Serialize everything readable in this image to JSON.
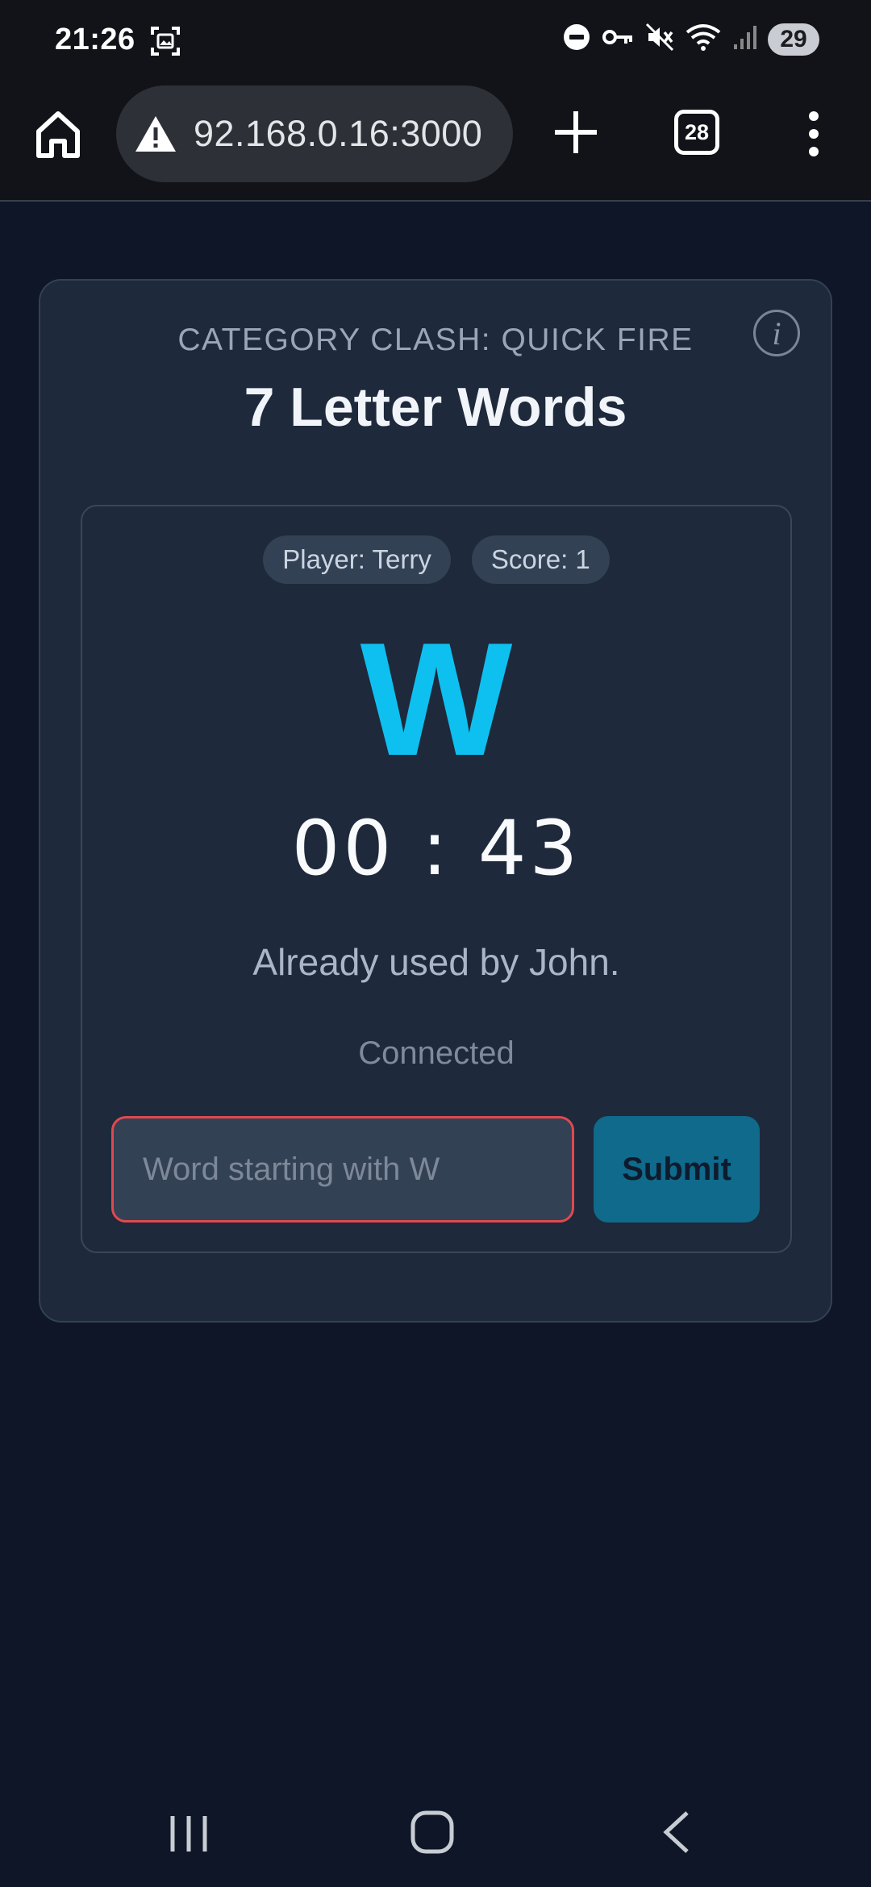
{
  "status_bar": {
    "time": "21:26",
    "battery": "29",
    "icons": [
      "screenshot-icon",
      "dnd-icon",
      "vpn-key-icon",
      "mute-icon",
      "wifi-icon",
      "signal-icon",
      "battery-icon"
    ]
  },
  "browser": {
    "url": "92.168.0.16:3000",
    "tab_count": "28",
    "icons": [
      "home-icon",
      "security-warning-icon",
      "new-tab-icon",
      "tabs-icon",
      "more-menu-icon"
    ]
  },
  "game": {
    "subtitle": "CATEGORY CLASH: QUICK FIRE",
    "title": "7 Letter Words",
    "player_badge": "Player: Terry",
    "score_badge": "Score: 1",
    "letter": "W",
    "timer": "00 : 43",
    "message": "Already used by John.",
    "connection": "Connected",
    "input_placeholder": "Word starting with W",
    "submit_label": "Submit",
    "info_symbol": "i"
  },
  "colors": {
    "background": "#0e1628",
    "card": "#1e293b",
    "accent_letter": "#0ec0f0",
    "submit_button": "#0f6a8c",
    "input_error_border": "#e0494f"
  },
  "nav_bar": {
    "icons": [
      "recents-icon",
      "home-nav-icon",
      "back-icon"
    ]
  }
}
